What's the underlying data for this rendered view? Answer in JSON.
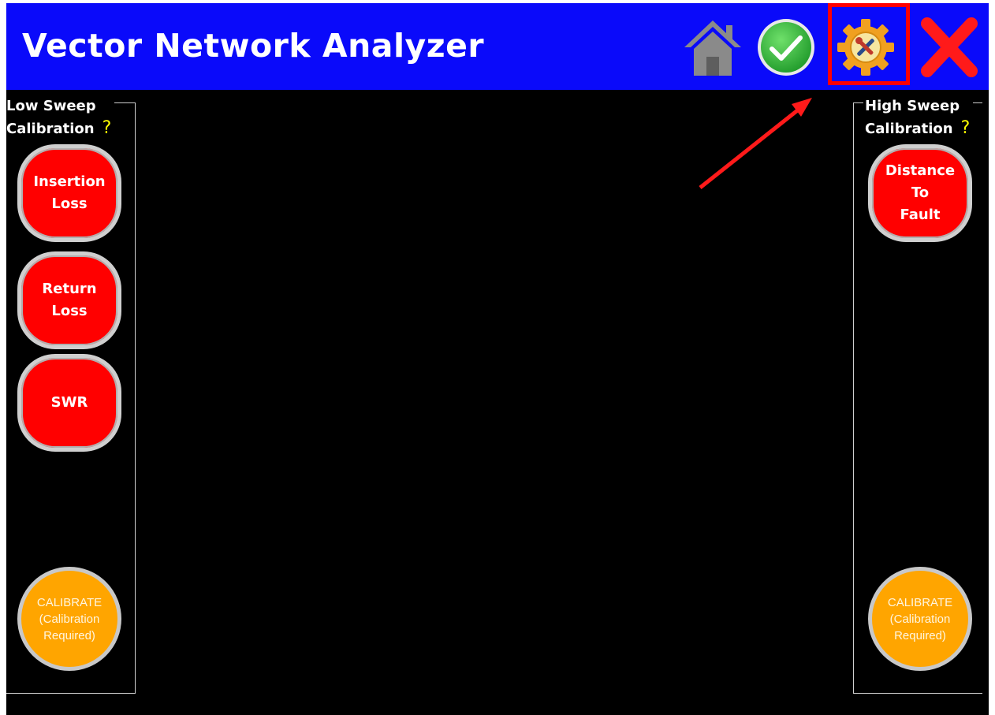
{
  "header": {
    "title": "Vector Network Analyzer",
    "icons": [
      "home-icon",
      "check-icon",
      "settings-icon",
      "close-icon"
    ]
  },
  "left_panel": {
    "title": "Low Sweep\nCalibration",
    "title_line1": "Low Sweep",
    "title_line2": "Calibration",
    "help": "?",
    "buttons": [
      {
        "label": "Insertion\nLoss"
      },
      {
        "label": "Return\nLoss"
      },
      {
        "label": "SWR"
      }
    ],
    "calibrate_label": "CALIBRATE\n(Calibration\nRequired)"
  },
  "right_panel": {
    "title_line1": "High Sweep",
    "title_line2": "Calibration",
    "help": "?",
    "buttons": [
      {
        "label": "Distance\nTo\nFault"
      }
    ],
    "calibrate_label": "CALIBRATE\n(Calibration\nRequired)"
  },
  "colors": {
    "header_bg": "#0a0afa",
    "screen_bg": "#000000",
    "mode_button": "#ff0000",
    "calibrate_button": "#ffa500",
    "help": "#ffff00",
    "highlight": "#ff0000"
  }
}
